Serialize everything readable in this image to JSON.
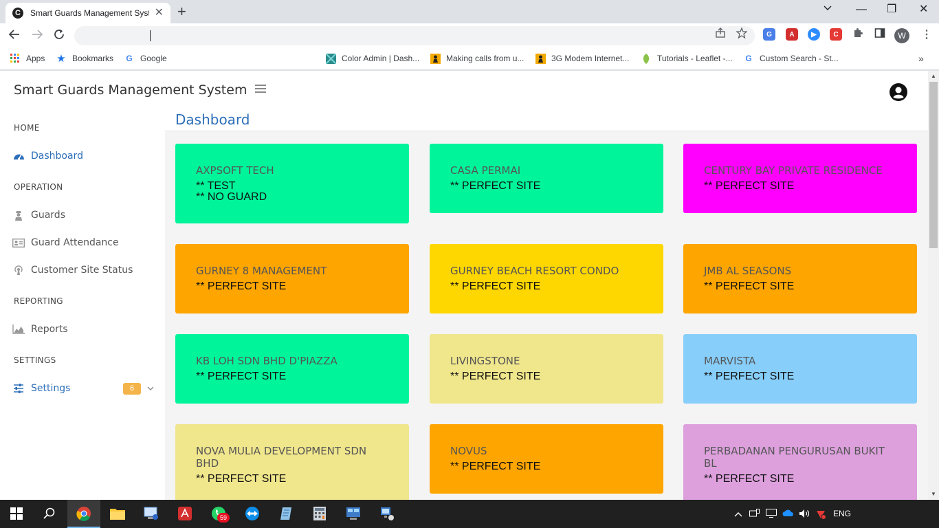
{
  "browser": {
    "tab_title": "Smart Guards Management System",
    "tab_favicon": "C",
    "new_tab": "+",
    "close": "✕",
    "minimize": "—",
    "restore": "❐",
    "window_close": "✕",
    "profile_initial": "W"
  },
  "bookmarks": [
    {
      "label": "Apps",
      "icon": "apps-grid-icon"
    },
    {
      "label": "Bookmarks",
      "icon": "star-icon"
    },
    {
      "label": "Google",
      "icon": "google-icon"
    },
    {
      "label": "Color Admin | Dash...",
      "icon": "color-admin-icon"
    },
    {
      "label": "Making calls from u...",
      "icon": "pawn-icon"
    },
    {
      "label": "3G Modem Internet...",
      "icon": "pawn-icon"
    },
    {
      "label": "Tutorials - Leaflet -...",
      "icon": "leaf-icon"
    },
    {
      "label": "Custom Search - St...",
      "icon": "google-icon"
    }
  ],
  "app": {
    "title": "Smart Guards Management System",
    "page_title": "Dashboard"
  },
  "sidebar": {
    "sections": {
      "home": "HOME",
      "operation": "OPERATION",
      "reporting": "REPORTING",
      "settings": "SETTINGS"
    },
    "items": {
      "dashboard": "Dashboard",
      "guards": "Guards",
      "attendance": "Guard Attendance",
      "site_status": "Customer Site Status",
      "reports": "Reports",
      "settings": "Settings",
      "settings_badge": "6"
    }
  },
  "sites": [
    {
      "name": "AXPSOFT TECH",
      "status": "** TEST",
      "status2": "** NO GUARD",
      "color": "#00f59b"
    },
    {
      "name": "CASA PERMAI",
      "status": "** PERFECT SITE",
      "color": "#00f59b"
    },
    {
      "name": "CENTURY BAY PRIVATE RESIDENCE",
      "status": "** PERFECT SITE",
      "color": "#ff00ff"
    },
    {
      "name": "GURNEY 8 MANAGEMENT",
      "status": "** PERFECT SITE",
      "color": "#ffa500"
    },
    {
      "name": "GURNEY BEACH RESORT CONDO",
      "status": "** PERFECT SITE",
      "color": "#ffd700"
    },
    {
      "name": "JMB AL SEASONS",
      "status": "** PERFECT SITE",
      "color": "#ffa500"
    },
    {
      "name": "KB LOH SDN BHD D'PIAZZA",
      "status": "** PERFECT SITE",
      "color": "#00f59b"
    },
    {
      "name": "LIVINGSTONE",
      "status": "** PERFECT SITE",
      "color": "#f0e68c"
    },
    {
      "name": "MARVISTA",
      "status": "** PERFECT SITE",
      "color": "#87cefa"
    },
    {
      "name": "NOVA MULIA DEVELOPMENT SDN BHD",
      "status": "** PERFECT SITE",
      "color": "#f0e68c"
    },
    {
      "name": "NOVUS",
      "status": "** PERFECT SITE",
      "color": "#ffa500"
    },
    {
      "name": "PERBADANAN PENGURUSAN BUKIT BL",
      "status": "** PERFECT SITE",
      "color": "#dda0dd"
    }
  ],
  "taskbar": {
    "whatsapp_badge": "59",
    "lang": "ENG"
  }
}
